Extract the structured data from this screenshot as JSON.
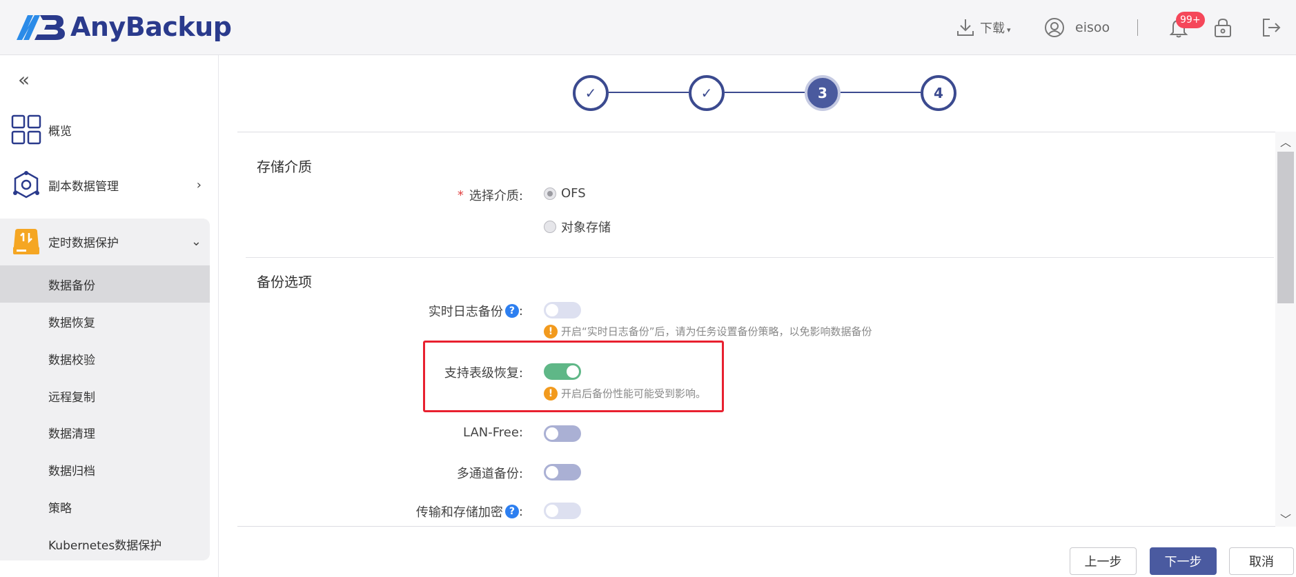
{
  "header": {
    "brand": "AnyBackup",
    "download_label": "下载",
    "username": "eisoo",
    "notification_badge": "99+"
  },
  "sidebar": {
    "collapse_icon": "«",
    "items": [
      {
        "label": "概览",
        "icon": "grid-icon"
      },
      {
        "label": "副本数据管理",
        "icon": "network-icon"
      },
      {
        "label": "定时数据保护",
        "icon": "drive-icon"
      }
    ],
    "subitems": [
      "数据备份",
      "数据恢复",
      "数据校验",
      "远程复制",
      "数据清理",
      "数据归档",
      "策略",
      "Kubernetes数据保护"
    ],
    "active_subitem": "数据备份"
  },
  "stepper": {
    "steps": [
      "✓",
      "✓",
      "3",
      "4"
    ],
    "current": 3
  },
  "storage": {
    "title": "存储介质",
    "select_label": "选择介质:",
    "required_mark": "*",
    "options": [
      "OFS",
      "对象存储"
    ],
    "selected": "OFS"
  },
  "backup_options": {
    "title": "备份选项",
    "realtime_log": {
      "label": "实时日志备份",
      "colon": ":",
      "help": "?",
      "on": false,
      "hint": "开启“实时日志备份”后，请为任务设置备份策略，以免影响数据备份"
    },
    "table_restore": {
      "label": "支持表级恢复:",
      "on": true,
      "hint": "开启后备份性能可能受到影响。"
    },
    "lan_free": {
      "label": "LAN-Free:",
      "on": false
    },
    "multichannel": {
      "label": "多通道备份:",
      "on": false
    },
    "encryption": {
      "label": "传输和存储加密",
      "colon": ":",
      "help": "?",
      "on": false
    }
  },
  "warn_icon_glyph": "!",
  "scroll": {
    "up": "︿",
    "down": "﹀"
  },
  "footer": {
    "prev": "上一步",
    "next": "下一步",
    "cancel": "取消"
  },
  "colors": {
    "brand": "#2a3a8c",
    "primary": "#4a5aa0",
    "toggle_on": "#5fb787",
    "warning": "#f29a1d",
    "badge": "#f5475a",
    "highlight": "#e8202f"
  }
}
